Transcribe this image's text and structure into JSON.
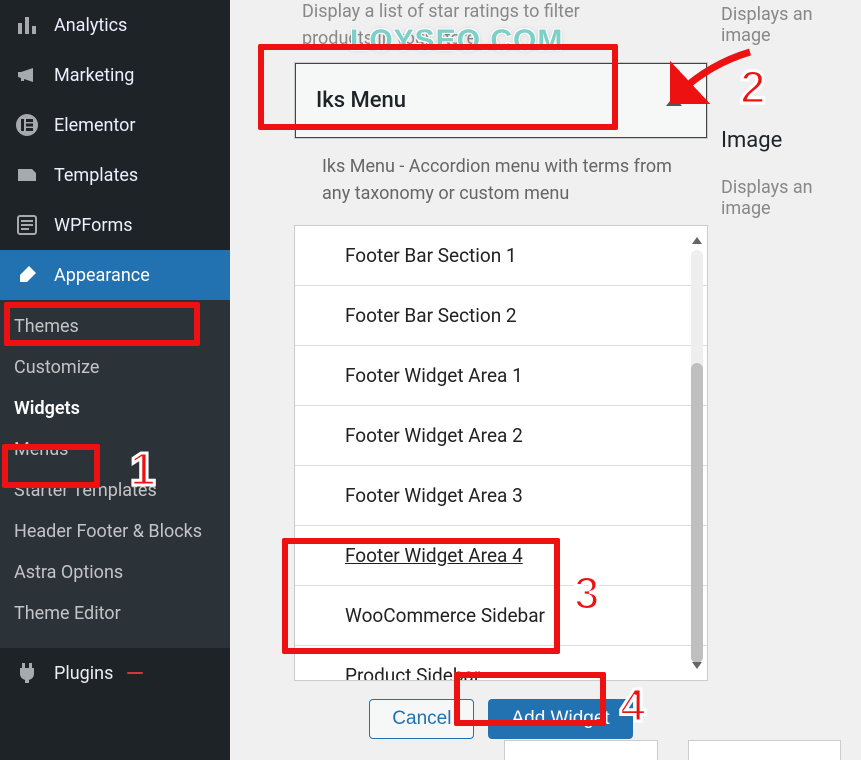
{
  "watermark": "LOYSEO.COM",
  "sidebar": {
    "items": [
      {
        "label": "Analytics",
        "icon": "analytics"
      },
      {
        "label": "Marketing",
        "icon": "megaphone"
      },
      {
        "label": "Elementor",
        "icon": "elementor"
      },
      {
        "label": "Templates",
        "icon": "templates"
      },
      {
        "label": "WPForms",
        "icon": "wpforms"
      },
      {
        "label": "Appearance",
        "icon": "brush",
        "active": true
      }
    ],
    "submenu": [
      {
        "label": "Themes"
      },
      {
        "label": "Customize"
      },
      {
        "label": "Widgets",
        "current": true
      },
      {
        "label": "Menus"
      },
      {
        "label": "Starter Templates"
      },
      {
        "label": "Header Footer & Blocks"
      },
      {
        "label": "Astra Options"
      },
      {
        "label": "Theme Editor"
      }
    ],
    "plugins": {
      "label": "Plugins",
      "badge": ""
    }
  },
  "widget_above_desc": "Display a list of star ratings to filter products in your store.",
  "widget": {
    "title": "Iks Menu",
    "description": "Iks Menu - Accordion menu with terms from any taxonomy or custom menu"
  },
  "areas": [
    "Footer Bar Section 1",
    "Footer Bar Section 2",
    "Footer Widget Area 1",
    "Footer Widget Area 2",
    "Footer Widget Area 3",
    "Footer Widget Area 4",
    "WooCommerce Sidebar",
    "Product Sidebar"
  ],
  "buttons": {
    "cancel": "Cancel",
    "add": "Add Widget"
  },
  "side_widget": {
    "desc1": "Displays an image",
    "title": "Image",
    "desc2": "Displays an image"
  },
  "annotations": {
    "n1": "1",
    "n2": "2",
    "n3": "3",
    "n4": "4"
  }
}
